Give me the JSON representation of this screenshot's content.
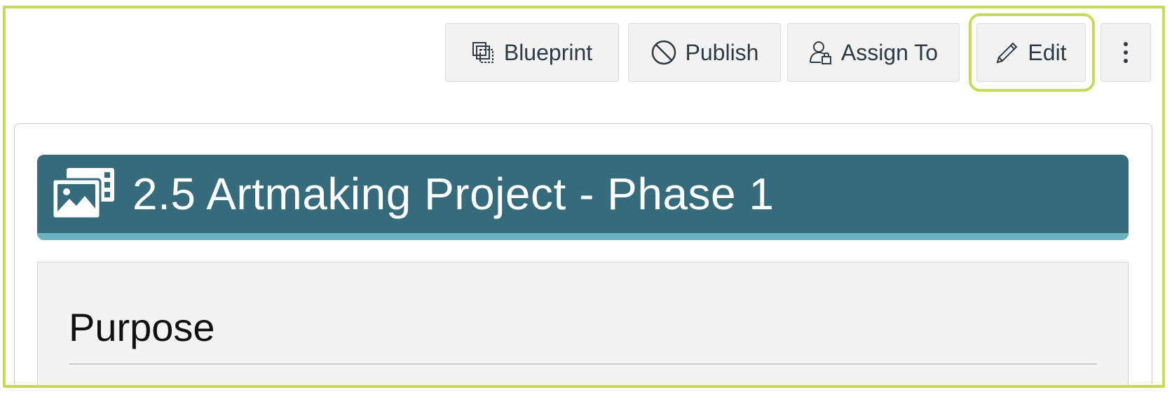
{
  "toolbar": {
    "blueprint_label": "Blueprint",
    "publish_label": "Publish",
    "assign_label": "Assign To",
    "edit_label": "Edit",
    "more_label": "⋮",
    "icons": {
      "blueprint": "blueprint-icon",
      "publish": "unpublished-circle-icon",
      "assign": "user-lock-icon",
      "edit": "pencil-icon",
      "more": "kebab-menu-icon"
    }
  },
  "banner": {
    "title": "2.5 Artmaking Project - Phase 1",
    "icon": "media-gallery-icon",
    "background_color": "#366b7c",
    "accent_color": "#69b3c3"
  },
  "section": {
    "heading": "Purpose"
  },
  "highlight_color": "#c5db5a"
}
